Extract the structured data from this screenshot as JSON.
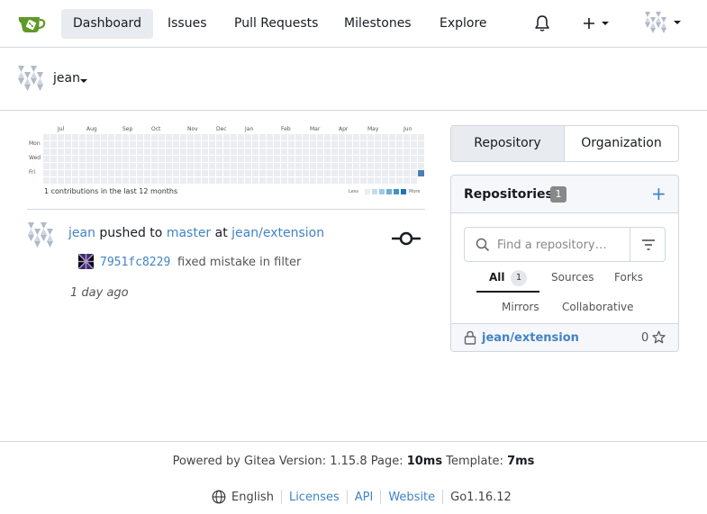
{
  "nav": {
    "items": [
      "Dashboard",
      "Issues",
      "Pull Requests",
      "Milestones",
      "Explore"
    ],
    "active": "Dashboard"
  },
  "context": {
    "user": "jean"
  },
  "heatmap": {
    "months": [
      "Jul",
      "Aug",
      "Sep",
      "Oct",
      "Nov",
      "Dec",
      "Jan",
      "Feb",
      "Mar",
      "Apr",
      "May",
      "Jun"
    ],
    "days": [
      "Mon",
      "Wed",
      "Fri"
    ],
    "summary": "1 contributions in the last 12 months",
    "less": "Less",
    "more": "More",
    "contribution_count": 1,
    "colors": [
      "#ebedf0",
      "#c6dbef",
      "#9ecae1",
      "#6baed6",
      "#4292c6",
      "#2171b5"
    ]
  },
  "feed": {
    "actor": "jean",
    "verb": "pushed to",
    "branch": "master",
    "at": "at",
    "repo": "jean/extension",
    "commit_sha": "7951fc8229",
    "commit_msg": "fixed mistake in filter",
    "time": "1 day ago"
  },
  "panel": {
    "tab_repo": "Repository",
    "tab_org": "Organization",
    "title": "Repositories",
    "count": "1",
    "search_placeholder": "Find a repository…",
    "filters": {
      "all": "All",
      "all_count": "1",
      "sources": "Sources",
      "forks": "Forks",
      "mirrors": "Mirrors",
      "collaborative": "Collaborative"
    },
    "repo_name": "jean/extension",
    "stars": "0"
  },
  "footer": {
    "powered": "Powered by Gitea Version: 1.15.8 Page:",
    "page_time": "10ms",
    "template_label": "Template:",
    "template_time": "7ms",
    "language": "English",
    "licenses": "Licenses",
    "api": "API",
    "website": "Website",
    "go_version": "Go1.16.12"
  },
  "colors": {
    "accent": "#4183c4",
    "gitea_green": "#609926"
  }
}
